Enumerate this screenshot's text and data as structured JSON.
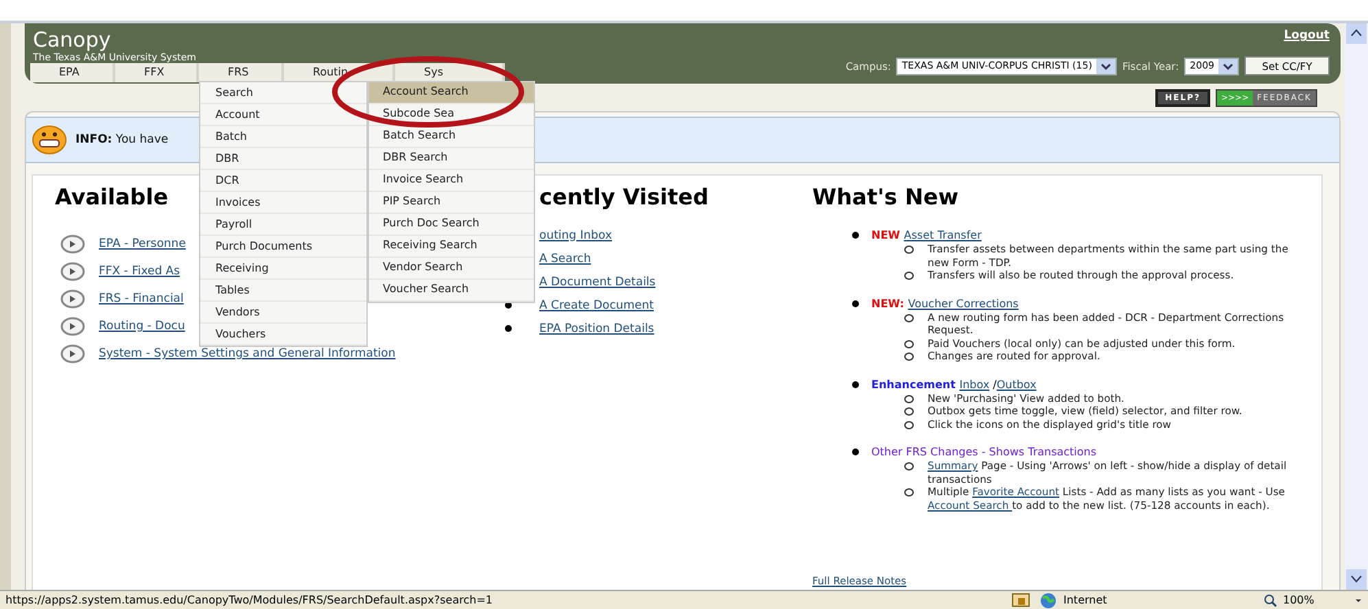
{
  "header": {
    "title": "Canopy",
    "subtitle": "The Texas A&M University System",
    "logout": "Logout",
    "campus": {
      "label": "Campus:",
      "value": "TEXAS A&M UNIV-CORPUS CHRISTI (15)"
    },
    "fiscal_year": {
      "label": "Fiscal Year:",
      "value": "2009"
    },
    "set_button": "Set CC/FY",
    "tabs": [
      "EPA",
      "FFX",
      "FRS",
      "Routin",
      "Sys"
    ]
  },
  "tools": {
    "help": "HELP?",
    "feedback_arrows": ">>>>",
    "feedback": "FEEDBACK"
  },
  "info": "**INFO:** You have",
  "available": {
    "heading": "Available",
    "links": [
      "EPA - Personne",
      "FFX - Fixed As",
      "FRS - Financial",
      "Routing - Docu",
      "System - System Settings and General Information"
    ]
  },
  "recent": {
    "heading": "cently Visited",
    "links": [
      "outing Inbox",
      "A Search",
      "A Document Details",
      "A Create Document",
      "EPA Position Details"
    ]
  },
  "whats_new": {
    "heading": "What's New",
    "items": [
      {
        "title": [
          {
            "kind": "new",
            "text": "NEW"
          },
          {
            "kind": "link",
            "text": "Asset Transfer"
          }
        ],
        "points": [
          [
            {
              "kind": "plain",
              "text": "Transfer assets between departments within the same part using the new Form - TDP."
            }
          ],
          [
            {
              "kind": "plain",
              "text": "Transfers will also be routed through the approval process."
            }
          ]
        ]
      },
      {
        "title": [
          {
            "kind": "new",
            "text": "NEW:"
          },
          {
            "kind": "link",
            "text": "Voucher Corrections"
          }
        ],
        "points": [
          [
            {
              "kind": "plain",
              "text": "A new routing form has been added - DCR - Department Corrections Request."
            }
          ],
          [
            {
              "kind": "plain",
              "text": "Paid Vouchers (local only) can be adjusted under this form."
            }
          ],
          [
            {
              "kind": "plain",
              "text": "Changes are routed for approval."
            }
          ]
        ]
      },
      {
        "title": [
          {
            "kind": "enhancement",
            "text": "Enhancement"
          },
          {
            "kind": "link",
            "text": "Inbox"
          },
          {
            "kind": "plain",
            "text": " /"
          },
          {
            "kind": "link",
            "text": "Outbox"
          }
        ],
        "points": [
          [
            {
              "kind": "plain",
              "text": "New 'Purchasing' View added to both."
            }
          ],
          [
            {
              "kind": "plain",
              "text": "Outbox gets time toggle, view (field) selector, and filter row."
            }
          ],
          [
            {
              "kind": "plain",
              "text": "Click the icons on the displayed grid's title row"
            }
          ]
        ]
      },
      {
        "title": [
          {
            "kind": "visited",
            "text": "Other FRS Changes - Shows Transactions"
          }
        ],
        "points": [
          [
            {
              "kind": "link",
              "text": "Summary"
            },
            {
              "kind": "plain",
              "text": " Page - Using 'Arrows' on left - show/hide a display of detail transactions"
            }
          ],
          [
            {
              "kind": "plain",
              "text": "Multiple "
            },
            {
              "kind": "link",
              "text": "Favorite Account"
            },
            {
              "kind": "plain",
              "text": " Lists - Add as many lists as you want - Use "
            },
            {
              "kind": "link",
              "text": "Account Search "
            },
            {
              "kind": "plain",
              "text": "to add to the new list. (75-128 accounts in each)."
            }
          ]
        ]
      }
    ],
    "release_notes": "Full Release Notes"
  },
  "menu": {
    "items": [
      "Search",
      "Account",
      "Batch",
      "DBR",
      "DCR",
      "Invoices",
      "Payroll",
      "Purch Documents",
      "Receiving",
      "Tables",
      "Vendors",
      "Vouchers"
    ],
    "submenu": [
      {
        "label": "Account Search",
        "selected": true
      },
      {
        "label": "Subcode Sea",
        "selected": false
      },
      {
        "label": "Batch Search",
        "selected": false
      },
      {
        "label": "DBR Search",
        "selected": false
      },
      {
        "label": "Invoice Search",
        "selected": false
      },
      {
        "label": "PIP Search",
        "selected": false
      },
      {
        "label": "Purch Doc Search",
        "selected": false
      },
      {
        "label": "Receiving Search",
        "selected": false
      },
      {
        "label": "Vendor Search",
        "selected": false
      },
      {
        "label": "Voucher Search",
        "selected": false
      }
    ]
  },
  "status_bar": {
    "url": "https://apps2.system.tamus.edu/CanopyTwo/Modules/FRS/SearchDefault.aspx?search=1",
    "zone": "Internet",
    "zoom": "100%"
  }
}
